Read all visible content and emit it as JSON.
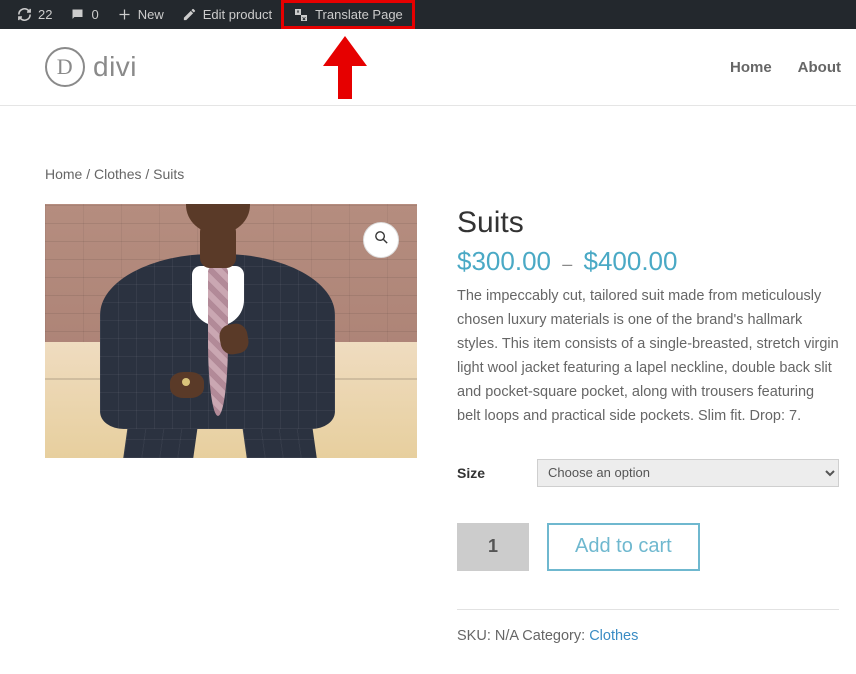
{
  "adminbar": {
    "updates_count": "22",
    "comments_count": "0",
    "new_label": "New",
    "edit_label": "Edit product",
    "translate_label": "Translate Page"
  },
  "header": {
    "logo_letter": "D",
    "logo_text": "divi",
    "nav": {
      "home": "Home",
      "about": "About"
    }
  },
  "breadcrumb": {
    "home": "Home",
    "cat": "Clothes",
    "current": "Suits"
  },
  "product": {
    "title": "Suits",
    "price_low_symbol": "$",
    "price_low": "300.00",
    "price_sep": "–",
    "price_high_symbol": "$",
    "price_high": "400.00",
    "description": "The impeccably cut, tailored suit made from meticulously chosen luxury materials is one of the brand's hallmark styles. This item consists of a single-breasted, stretch virgin light wool jacket featuring a lapel neckline, double back slit and pocket-square pocket, along with trousers featuring belt loops and practical side pockets. Slim fit. Drop: 7.",
    "variation_label": "Size",
    "variation_placeholder": "Choose an option",
    "qty_value": "1",
    "add_to_cart_label": "Add to cart",
    "sku_label": "SKU:",
    "sku_value": "N/A",
    "category_label": "Category:",
    "category_value": "Clothes"
  }
}
